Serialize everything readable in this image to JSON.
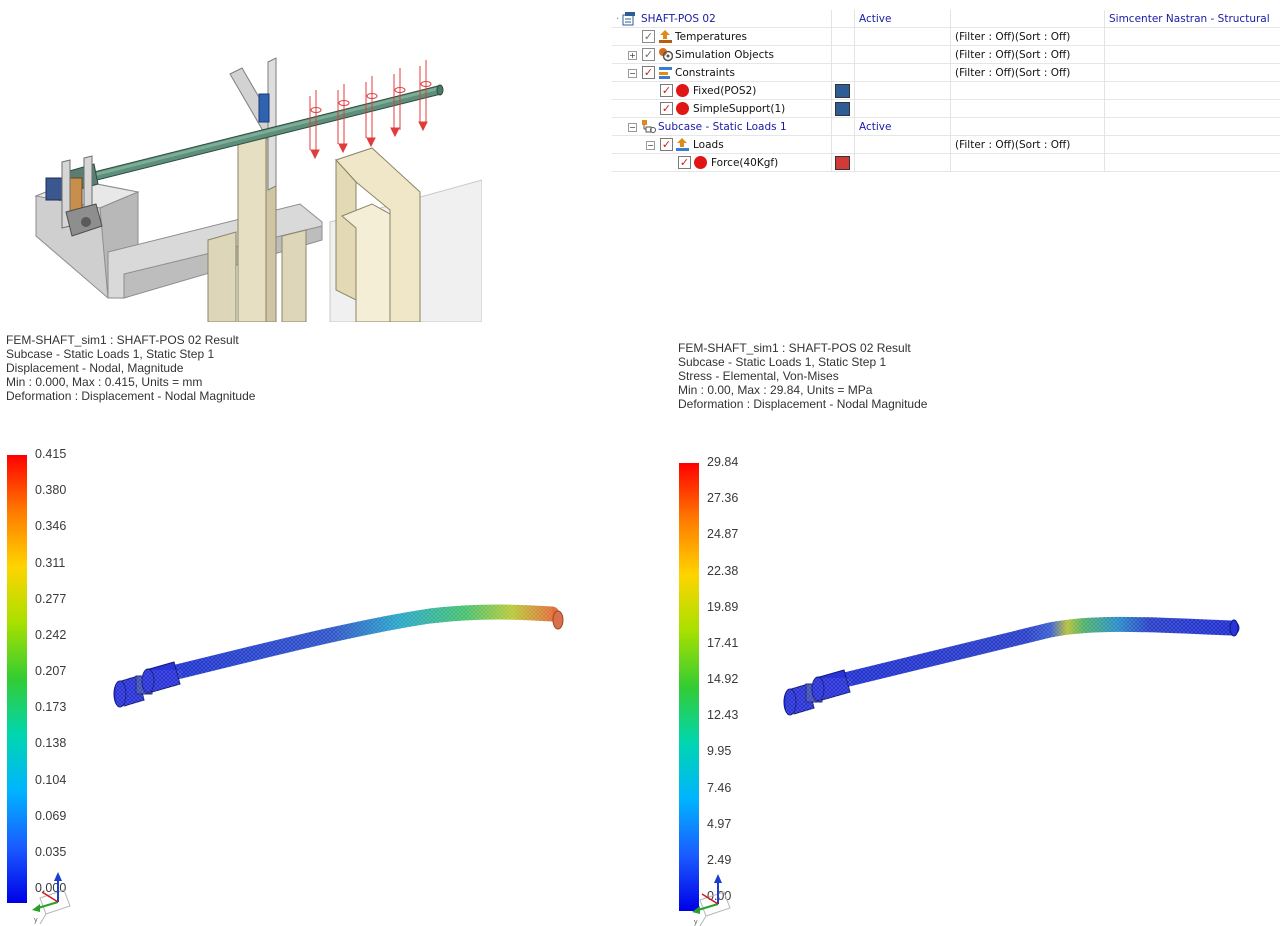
{
  "navigator": {
    "rows": [
      {
        "name": "SHAFT-POS 02",
        "status": "Active",
        "filter": "",
        "solver": "Simcenter Nastran - Structural"
      },
      {
        "name": "Temperatures",
        "status": "",
        "filter": "(Filter : Off)(Sort : Off)",
        "solver": ""
      },
      {
        "name": "Simulation Objects",
        "status": "",
        "filter": "(Filter : Off)(Sort : Off)",
        "solver": ""
      },
      {
        "name": "Constraints",
        "status": "",
        "filter": "(Filter : Off)(Sort : Off)",
        "solver": ""
      },
      {
        "name": "Fixed(POS2)",
        "status": "",
        "filter": "",
        "solver": "",
        "color": "#2e5c94"
      },
      {
        "name": "SimpleSupport(1)",
        "status": "",
        "filter": "",
        "solver": "",
        "color": "#2e5c94"
      },
      {
        "name": "Subcase - Static Loads 1",
        "status": "Active",
        "filter": "",
        "solver": ""
      },
      {
        "name": "Loads",
        "status": "",
        "filter": "(Filter : Off)(Sort : Off)",
        "solver": ""
      },
      {
        "name": "Force(40Kgf)",
        "status": "",
        "filter": "",
        "solver": "",
        "color": "#d23a3a"
      }
    ]
  },
  "displacement_result": {
    "header": [
      "FEM-SHAFT_sim1 : SHAFT-POS 02 Result",
      "Subcase - Static Loads 1, Static Step 1",
      "Displacement - Nodal, Magnitude",
      "Min : 0.000, Max : 0.415, Units = mm",
      "Deformation : Displacement - Nodal Magnitude"
    ],
    "legend": [
      "0.415",
      "0.380",
      "0.346",
      "0.311",
      "0.277",
      "0.242",
      "0.207",
      "0.173",
      "0.138",
      "0.104",
      "0.069",
      "0.035",
      "0.000"
    ]
  },
  "stress_result": {
    "header": [
      "FEM-SHAFT_sim1 : SHAFT-POS 02 Result",
      "Subcase - Static Loads 1, Static Step 1",
      "Stress - Elemental, Von-Mises",
      "Min : 0.00, Max : 29.84, Units = MPa",
      "Deformation : Displacement - Nodal Magnitude"
    ],
    "legend": [
      "29.84",
      "27.36",
      "24.87",
      "22.38",
      "19.89",
      "17.41",
      "14.92",
      "12.43",
      "9.95",
      "7.46",
      "4.97",
      "2.49",
      "0.00"
    ]
  },
  "colors": {
    "legend_gradient": [
      "#ff0000",
      "#ff7a00",
      "#ffd400",
      "#a8e000",
      "#33cc33",
      "#00d6b0",
      "#00b4ff",
      "#1a5cff",
      "#0000e6"
    ],
    "link": "#1a1aa6",
    "shaft": "#3c5fae"
  }
}
